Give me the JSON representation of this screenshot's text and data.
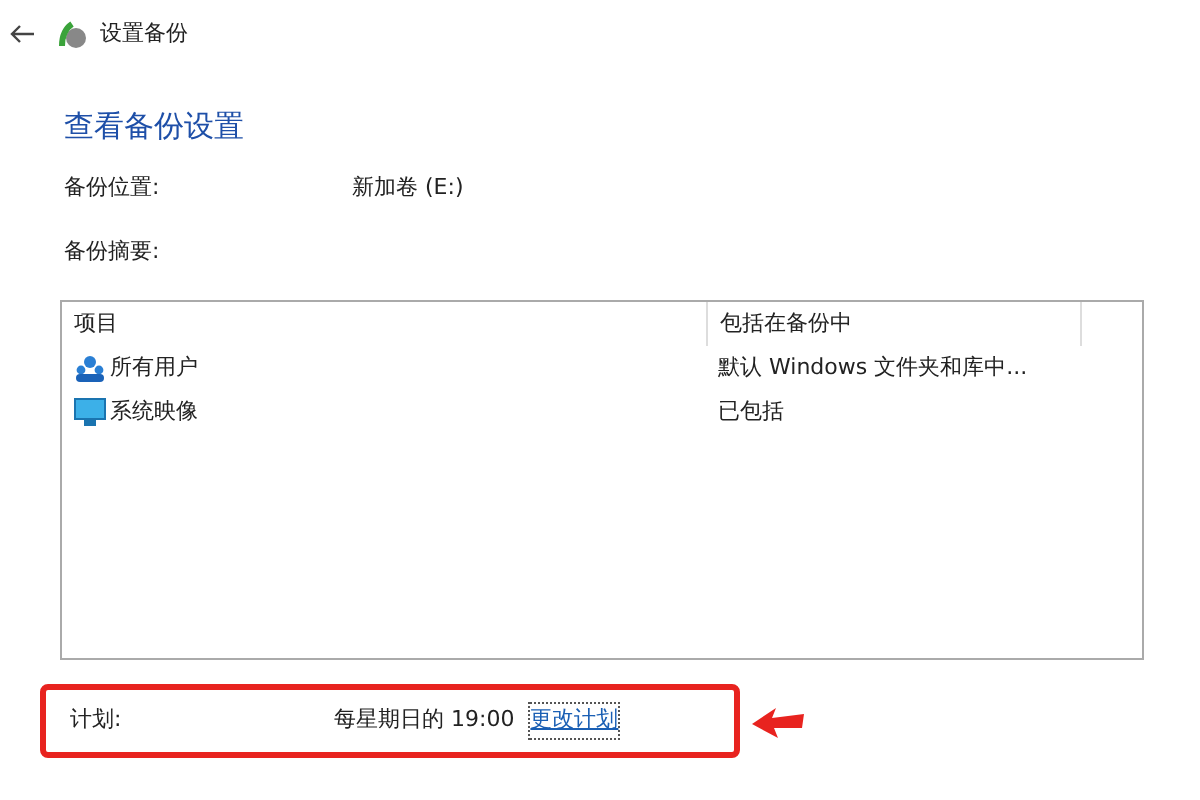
{
  "window": {
    "title": "设置备份"
  },
  "heading": "查看备份设置",
  "location": {
    "label": "备份位置:",
    "value": "新加卷 (E:)"
  },
  "summary": {
    "label": "备份摘要:"
  },
  "table": {
    "columns": [
      "项目",
      "包括在备份中"
    ],
    "rows": [
      {
        "kind": "users",
        "item": "所有用户",
        "included": "默认 Windows 文件夹和库中..."
      },
      {
        "kind": "image",
        "item": "系统映像",
        "included": "已包括"
      }
    ]
  },
  "schedule": {
    "label": "计划:",
    "value": "每星期日的 19:00",
    "link": "更改计划",
    "highlighted": true
  }
}
